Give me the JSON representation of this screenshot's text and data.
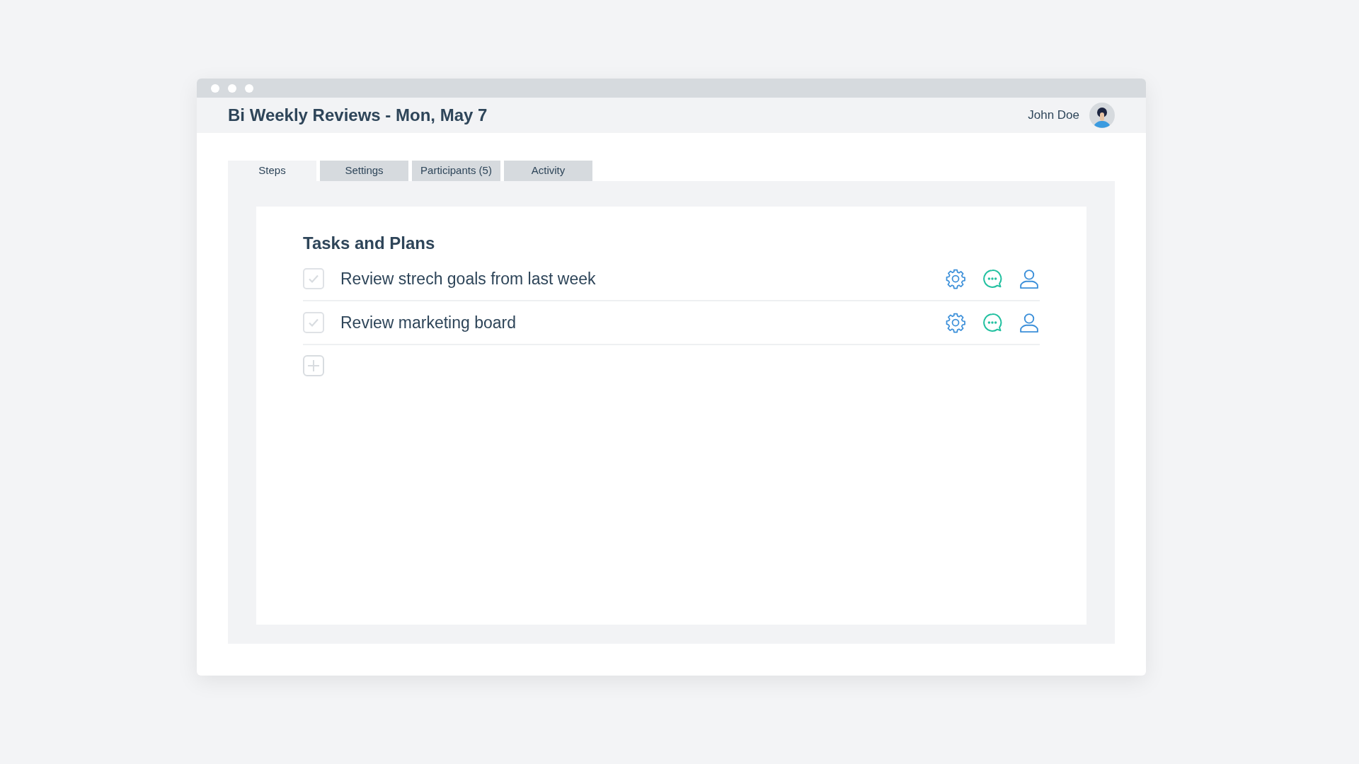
{
  "window": {
    "title": "Bi Weekly Reviews - Mon, May 7",
    "user": "John Doe"
  },
  "tabs": [
    {
      "label": "Steps",
      "selected": true
    },
    {
      "label": "Settings",
      "selected": false
    },
    {
      "label": "Participants (5)",
      "selected": false
    },
    {
      "label": "Activity",
      "selected": false
    }
  ],
  "section": {
    "title": "Tasks and Plans"
  },
  "tasks": [
    {
      "label": "Review strech goals from last week",
      "checked": false
    },
    {
      "label": "Review marketing board",
      "checked": false
    }
  ]
}
